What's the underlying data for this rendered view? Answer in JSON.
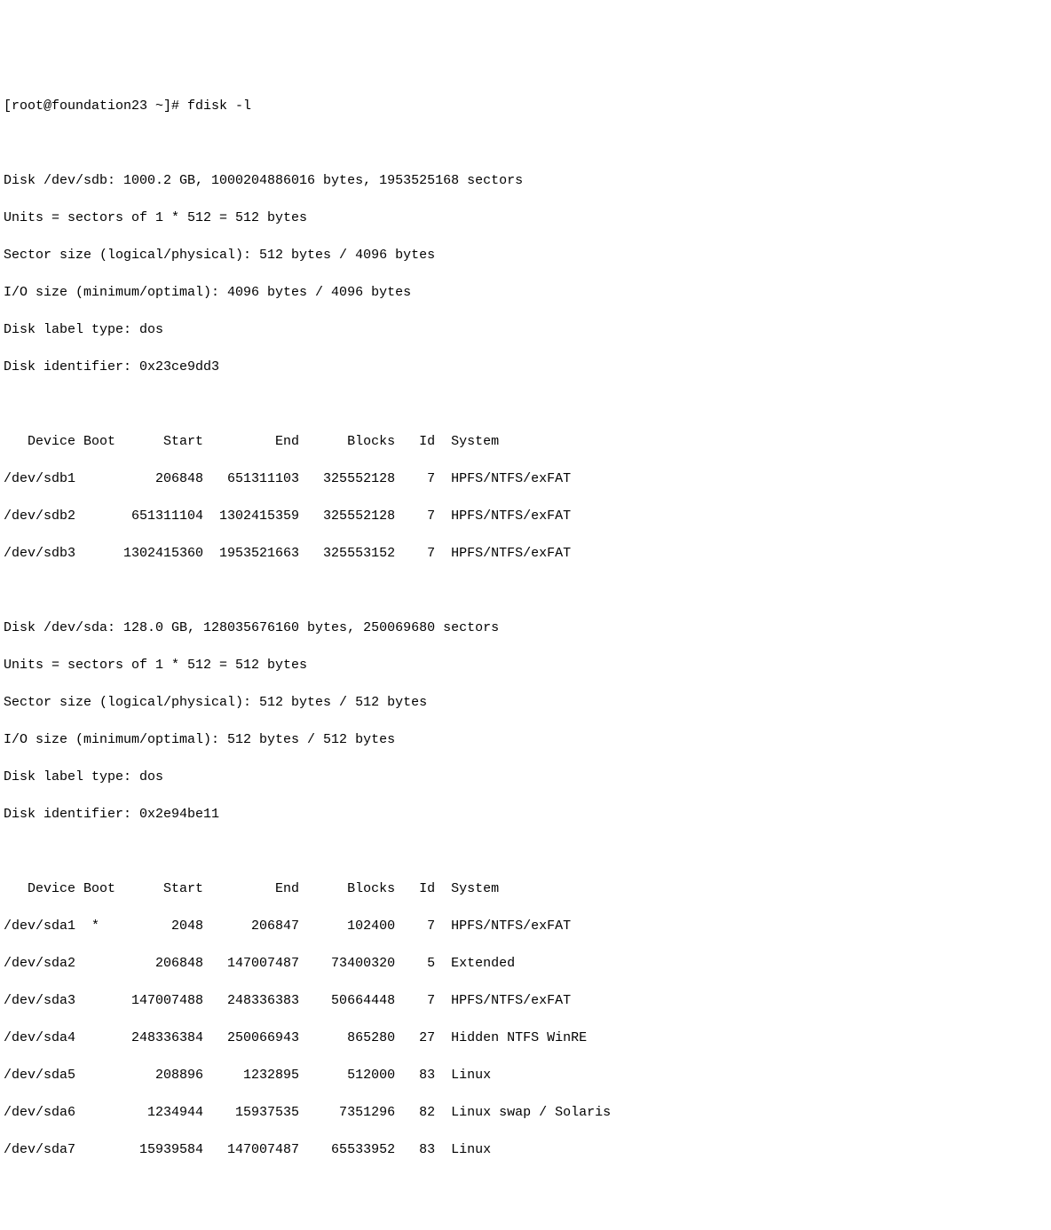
{
  "prompt": "[root@foundation23 ~]# ",
  "command": "fdisk -l",
  "disks": [
    {
      "header": [
        "Disk /dev/sdb: 1000.2 GB, 1000204886016 bytes, 1953525168 sectors",
        "Units = sectors of 1 * 512 = 512 bytes",
        "Sector size (logical/physical): 512 bytes / 4096 bytes",
        "I/O size (minimum/optimal): 4096 bytes / 4096 bytes",
        "Disk label type: dos",
        "Disk identifier: 0x23ce9dd3"
      ],
      "table_header": {
        "device": "Device",
        "boot": "Boot",
        "start": "Start",
        "end": "End",
        "blocks": "Blocks",
        "id": "Id",
        "system": "System"
      },
      "partitions": [
        {
          "device": "/dev/sdb1",
          "boot": "",
          "start": "206848",
          "end": "651311103",
          "blocks": "325552128",
          "id": "7",
          "system": "HPFS/NTFS/exFAT"
        },
        {
          "device": "/dev/sdb2",
          "boot": "",
          "start": "651311104",
          "end": "1302415359",
          "blocks": "325552128",
          "id": "7",
          "system": "HPFS/NTFS/exFAT"
        },
        {
          "device": "/dev/sdb3",
          "boot": "",
          "start": "1302415360",
          "end": "1953521663",
          "blocks": "325553152",
          "id": "7",
          "system": "HPFS/NTFS/exFAT"
        }
      ]
    },
    {
      "header": [
        "Disk /dev/sda: 128.0 GB, 128035676160 bytes, 250069680 sectors",
        "Units = sectors of 1 * 512 = 512 bytes",
        "Sector size (logical/physical): 512 bytes / 512 bytes",
        "I/O size (minimum/optimal): 512 bytes / 512 bytes",
        "Disk label type: dos",
        "Disk identifier: 0x2e94be11"
      ],
      "table_header": {
        "device": "Device",
        "boot": "Boot",
        "start": "Start",
        "end": "End",
        "blocks": "Blocks",
        "id": "Id",
        "system": "System"
      },
      "partitions": [
        {
          "device": "/dev/sda1",
          "boot": "*",
          "start": "2048",
          "end": "206847",
          "blocks": "102400",
          "id": "7",
          "system": "HPFS/NTFS/exFAT"
        },
        {
          "device": "/dev/sda2",
          "boot": "",
          "start": "206848",
          "end": "147007487",
          "blocks": "73400320",
          "id": "5",
          "system": "Extended"
        },
        {
          "device": "/dev/sda3",
          "boot": "",
          "start": "147007488",
          "end": "248336383",
          "blocks": "50664448",
          "id": "7",
          "system": "HPFS/NTFS/exFAT"
        },
        {
          "device": "/dev/sda4",
          "boot": "",
          "start": "248336384",
          "end": "250066943",
          "blocks": "865280",
          "id": "27",
          "system": "Hidden NTFS WinRE"
        },
        {
          "device": "/dev/sda5",
          "boot": "",
          "start": "208896",
          "end": "1232895",
          "blocks": "512000",
          "id": "83",
          "system": "Linux"
        },
        {
          "device": "/dev/sda6",
          "boot": "",
          "start": "1234944",
          "end": "15937535",
          "blocks": "7351296",
          "id": "82",
          "system": "Linux swap / Solaris"
        },
        {
          "device": "/dev/sda7",
          "boot": "",
          "start": "15939584",
          "end": "147007487",
          "blocks": "65533952",
          "id": "83",
          "system": "Linux"
        }
      ]
    }
  ]
}
